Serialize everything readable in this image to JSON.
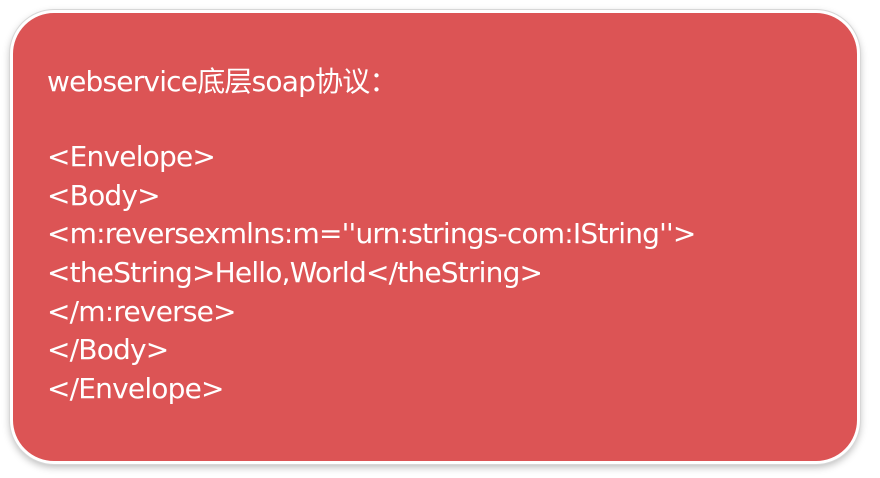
{
  "slide": {
    "title": "webservice底层soap协议：",
    "colors": {
      "card_background": "#dc5455",
      "text": "#ffffff",
      "border": "#ffffff"
    },
    "code_lines": [
      "<Envelope>",
      "<Body>",
      "<m:reversexmlns:m=''urn:strings-com:IString''>",
      "<theString>Hello,World</theString>",
      "</m:reverse>",
      "</Body>",
      "</Envelope>"
    ]
  }
}
